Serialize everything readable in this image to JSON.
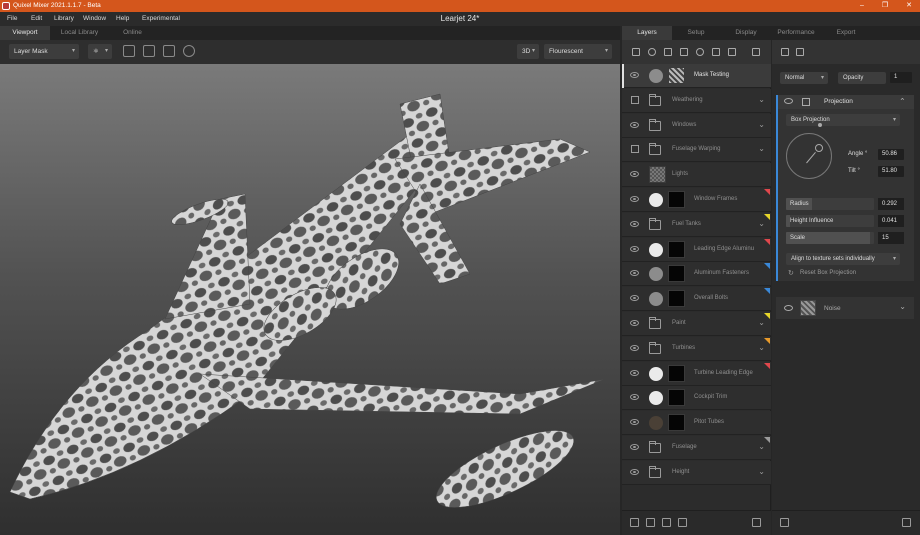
{
  "titlebar": {
    "title": "Quixel Mixer 2021.1.1.7 - Beta",
    "minimize": "–",
    "maximize": "❐",
    "close": "✕"
  },
  "menu": [
    "File",
    "Edit",
    "Library",
    "Window",
    "Help",
    "Experimental"
  ],
  "document_title": "Learjet 24*",
  "viewport_tabs": [
    "Viewport",
    "Local Library",
    "Online"
  ],
  "viewport_toolbar": {
    "view_mode": "Layer Mask",
    "render_mode": "3D",
    "lighting": "Flourescent"
  },
  "right_tabs": [
    "Layers",
    "Setup",
    "Display",
    "Performance",
    "Export"
  ],
  "layers": [
    {
      "name": "Mask Testing",
      "kind": "layer",
      "vis": "eye",
      "swatch": "grey",
      "thumb": "pattern",
      "selected": true
    },
    {
      "name": "Weathering",
      "kind": "folder",
      "vis": "checkbox"
    },
    {
      "name": "Windows",
      "kind": "folder",
      "vis": "eye"
    },
    {
      "name": "Fuselage Warping",
      "kind": "folder",
      "vis": "checkbox"
    },
    {
      "name": "Lights",
      "kind": "layer",
      "vis": "eye",
      "thumb": "checker"
    },
    {
      "name": "Window Frames",
      "kind": "layer",
      "vis": "eye",
      "swatch": "white",
      "thumb": "black",
      "flag": "#e0474c"
    },
    {
      "name": "Fuel Tanks",
      "kind": "folder",
      "vis": "eye",
      "flag": "#e6d52a"
    },
    {
      "name": "Leading Edge Aluminu",
      "kind": "layer",
      "vis": "eye",
      "swatch": "white",
      "thumb": "black",
      "flag": "#e0474c"
    },
    {
      "name": "Aluminum Fasteners",
      "kind": "layer",
      "vis": "eye",
      "swatch": "grey",
      "thumb": "black",
      "flag": "#3a88d8"
    },
    {
      "name": "Overall Bolts",
      "kind": "layer",
      "vis": "eye",
      "swatch": "grey",
      "thumb": "black",
      "flag": "#3a88d8"
    },
    {
      "name": "Paint",
      "kind": "folder",
      "vis": "eye",
      "flag": "#e6d52a"
    },
    {
      "name": "Turbines",
      "kind": "folder",
      "vis": "eye",
      "flag": "#e89a2a"
    },
    {
      "name": "Turbine Leading Edge",
      "kind": "layer",
      "vis": "eye",
      "swatch": "white",
      "thumb": "black",
      "flag": "#e0474c"
    },
    {
      "name": "Cockpit Trim",
      "kind": "layer",
      "vis": "eye",
      "swatch": "white",
      "thumb": "black"
    },
    {
      "name": "Pitot Tubes",
      "kind": "layer",
      "vis": "eye",
      "swatch": "dark",
      "thumb": "black"
    },
    {
      "name": "Fuselage",
      "kind": "folder",
      "vis": "eye",
      "flag": "#9a9a9a"
    },
    {
      "name": "Height",
      "kind": "folder",
      "vis": "eye"
    }
  ],
  "properties": {
    "blend_mode": "Normal",
    "opacity_label": "Opacity",
    "opacity_value": "1",
    "projection": {
      "title": "Projection",
      "type": "Box Projection",
      "angle_label": "Angle °",
      "angle_value": "50.86",
      "tilt_label": "Tilt °",
      "tilt_value": "51.80",
      "radius_label": "Radius",
      "radius_value": "0.292",
      "radius_level": 0.3,
      "height_label": "Height Influence",
      "height_value": "0.041",
      "height_level": 0.04,
      "scale_label": "Scale",
      "scale_value": "15",
      "scale_level": 0.95,
      "align_mode": "Align to texture sets individually",
      "reset_label": "Reset Box Projection"
    },
    "noise": {
      "title": "Noise"
    }
  },
  "icons": {
    "chevron": "⌄",
    "dropdown": "▾"
  }
}
